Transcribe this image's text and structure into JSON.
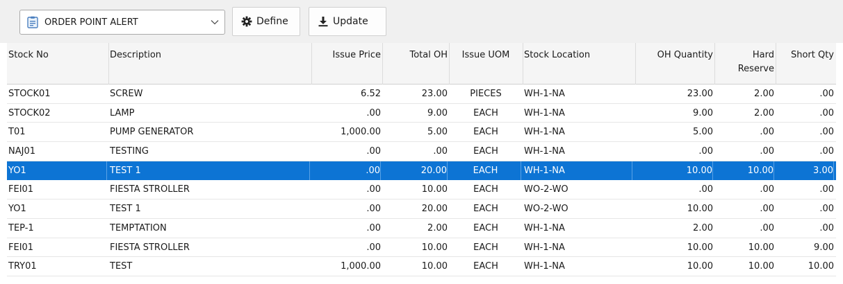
{
  "toolbar": {
    "report_select": {
      "value": "ORDER POINT ALERT",
      "icon": "report-icon"
    },
    "define_label": "Define",
    "define_icon": "gear-icon",
    "update_label": "Update",
    "update_icon": "download-icon"
  },
  "grid": {
    "columns": [
      {
        "key": "stock_no",
        "label": "Stock No",
        "align": "l"
      },
      {
        "key": "description",
        "label": "Description",
        "align": "l"
      },
      {
        "key": "issue_price",
        "label": "Issue Price",
        "align": "r"
      },
      {
        "key": "total_oh",
        "label": "Total OH",
        "align": "r"
      },
      {
        "key": "issue_uom",
        "label": "Issue UOM",
        "align": "c"
      },
      {
        "key": "stock_location",
        "label": "Stock Location",
        "align": "l"
      },
      {
        "key": "oh_quantity",
        "label": "OH Quantity",
        "align": "r"
      },
      {
        "key": "hard_reserve",
        "label": "Hard\nReserve",
        "align": "r"
      },
      {
        "key": "short_qty",
        "label": "Short Qty",
        "align": "r"
      }
    ],
    "rows": [
      {
        "selected": false,
        "cells": [
          "STOCK01",
          "SCREW",
          "6.52",
          "23.00",
          "PIECES",
          "WH-1-NA",
          "23.00",
          "2.00",
          ".00"
        ]
      },
      {
        "selected": false,
        "cells": [
          "STOCK02",
          "LAMP",
          ".00",
          "9.00",
          "EACH",
          "WH-1-NA",
          "9.00",
          "2.00",
          ".00"
        ]
      },
      {
        "selected": false,
        "cells": [
          "T01",
          "PUMP GENERATOR",
          "1,000.00",
          "5.00",
          "EACH",
          "WH-1-NA",
          "5.00",
          ".00",
          ".00"
        ]
      },
      {
        "selected": false,
        "cells": [
          "NAJ01",
          "TESTING",
          ".00",
          ".00",
          "EACH",
          "WH-1-NA",
          ".00",
          ".00",
          ".00"
        ]
      },
      {
        "selected": true,
        "cells": [
          "YO1",
          "TEST 1",
          ".00",
          "20.00",
          "EACH",
          "WH-1-NA",
          "10.00",
          "10.00",
          "3.00"
        ]
      },
      {
        "selected": false,
        "cells": [
          "FEI01",
          "FIESTA STROLLER",
          ".00",
          "10.00",
          "EACH",
          "WO-2-WO",
          ".00",
          ".00",
          ".00"
        ]
      },
      {
        "selected": false,
        "cells": [
          "YO1",
          "TEST 1",
          ".00",
          "20.00",
          "EACH",
          "WO-2-WO",
          "10.00",
          ".00",
          ".00"
        ]
      },
      {
        "selected": false,
        "cells": [
          "TEP-1",
          "TEMPTATION",
          ".00",
          "2.00",
          "EACH",
          "WH-1-NA",
          "2.00",
          ".00",
          ".00"
        ]
      },
      {
        "selected": false,
        "cells": [
          "FEI01",
          "FIESTA STROLLER",
          ".00",
          "10.00",
          "EACH",
          "WH-1-NA",
          "10.00",
          "10.00",
          "9.00"
        ]
      },
      {
        "selected": false,
        "cells": [
          "TRY01",
          "TEST",
          "1,000.00",
          "10.00",
          "EACH",
          "WH-1-NA",
          "10.00",
          "10.00",
          "10.00"
        ]
      }
    ]
  },
  "colors": {
    "selection": "#0d74d4",
    "toolbar_bg": "#f0f0f0",
    "header_bg": "#f5f5f5"
  }
}
